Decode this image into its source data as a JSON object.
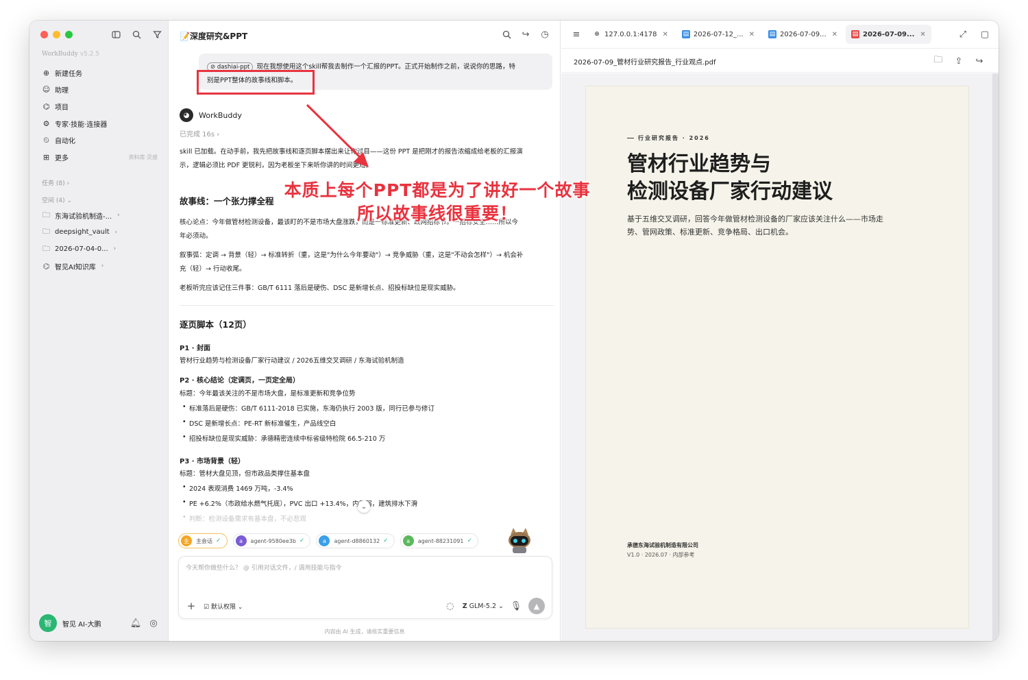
{
  "sidebar": {
    "brand": "WorkBuddy",
    "version": "v5.2.5",
    "nav": [
      {
        "label": "新建任务",
        "icon": "plus-circle-icon"
      },
      {
        "label": "助理",
        "icon": "assistant-icon"
      },
      {
        "label": "项目",
        "icon": "project-icon"
      },
      {
        "label": "专家·技能·连接器",
        "icon": "expert-icon"
      },
      {
        "label": "自动化",
        "icon": "automation-icon"
      },
      {
        "label": "更多",
        "icon": "more-grid-icon",
        "hint": "资料库·灵感"
      }
    ],
    "tasks_section": "任务 (8)",
    "spaces_section": "空间 (4)",
    "projects": [
      {
        "label": "东海试验机制造-..."
      },
      {
        "label": "deepsight_vault"
      },
      {
        "label": "2026-07-04-0..."
      },
      {
        "label": "智见AI知识库"
      }
    ],
    "user": {
      "name": "智见 AI-大鹏",
      "avatar": "智"
    }
  },
  "chat": {
    "title": "📝深度研究&PPT",
    "user_message": {
      "mention": "dashiai-ppt",
      "line1": "现在我想使用这个skill帮我去制作一个汇报的PPT。正式开始制作之前，说说你的思路，特",
      "line2": "别是PPT整体的故事线和脚本。"
    },
    "assistant_name": "WorkBuddy",
    "status": "已完成 16s",
    "intro_line1": "skill 已加载。在动手前，我先把故事线和逐页脚本摆出来让你过目——这份 PPT 是把刚才的报告浓缩成给老板的汇报演",
    "intro_line2": "示，逻辑必须比 PDF 更锐利，因为老板坐下来听你讲的时间更短。",
    "story_heading": "故事线：一个张力撑全程",
    "core_line1": "核心论点：今年做管材检测设备，最该盯的不是市场大盘涨跌，而是一标准更新、政网招标节。一招标安全……所以今",
    "core_line2": "年必须动。",
    "arc_line1": "叙事弧：定调 → 背景（轻）→ 标准转折（重，这是\"为什么今年要动\"）→ 竞争威胁（重，这是\"不动会怎样\"）→ 机会补",
    "arc_line2": "充（轻）→ 行动收尾。",
    "remember": "老板听完应该记住三件事：GB/T 6111 落后是硬伤、DSC 是新增长点、招投标缺位是现实威胁。",
    "script_heading": "逐页脚本（12页）",
    "pages": [
      {
        "title": "P1 · 封面",
        "headline": "管材行业趋势与检测设备厂家行动建议 / 2026五维交叉调研 / 东海试验机制造",
        "bullets": []
      },
      {
        "title": "P2 · 核心结论（定调页，一页定全局）",
        "headline": "标题：今年最该关注的不是市场大盘，是标准更新和竞争位势",
        "bullets": [
          "标准落后是硬伤：GB/T 6111-2018 已实施，东海仍执行 2003 版，同行已参与修订",
          "DSC 是新增长点：PE-RT 新标准催生，产品线空白",
          "招投标缺位是现实威胁：承德精密连续中标省级特检院 66.5-210 万"
        ]
      },
      {
        "title": "P3 · 市场背景（轻）",
        "headline": "标题：管材大盘见顶，但市政品类撑住基本盘",
        "bullets": [
          "2024 表观消费 1469 万吨，-3.4%",
          "PE +6.2%（市政给水燃气托底），PVC 出口 +13.4%，内需弱，建筑排水下滑",
          "判断：检测设备需求有基本盘，不必悲观"
        ]
      }
    ],
    "agents": [
      {
        "label": "主会话",
        "avatar": "主",
        "color": "#f5a623"
      },
      {
        "label": "agent-9580ee3b",
        "avatar": "a",
        "color": "#7b5cd6"
      },
      {
        "label": "agent-d8860132",
        "avatar": "a",
        "color": "#3aa0e8"
      },
      {
        "label": "agent-88231091",
        "avatar": "a",
        "color": "#5cb85c"
      }
    ],
    "input_placeholder": "今天帮你做些什么？ @ 引用对话文件，/ 调用技能与指令",
    "permission": "默认权限",
    "model": "GLM-5.2",
    "disclaimer": "内容由 AI 生成，请核实重要信息"
  },
  "annotation": {
    "line1": "本质上每个PPT都是为了讲好一个故事",
    "line2": "所以故事线很重要！",
    "color": "#e8333f"
  },
  "viewer": {
    "tabs": [
      {
        "label": "127.0.0.1:4178",
        "icon": "globe-icon"
      },
      {
        "label": "2026-07-12_...",
        "icon": "doc-icon"
      },
      {
        "label": "2026-07-09...",
        "icon": "doc-icon"
      },
      {
        "label": "2026-07-09...",
        "icon": "pdf-icon",
        "active": true
      }
    ],
    "filename": "2026-07-09_管材行业研究报告_行业观点.pdf",
    "page": {
      "kicker": "行业研究报告 · 2026",
      "title_line1": "管材行业趋势与",
      "title_line2": "检测设备厂家行动建议",
      "subtitle": "基于五维交叉调研，回答今年做管材检测设备的厂家应该关注什么——市场走势、管网政策、标准更新、竞争格局、出口机会。",
      "org": "承德东海试验机制造有限公司",
      "version": "V1.0 · 2026.07 · 内部参考"
    }
  }
}
